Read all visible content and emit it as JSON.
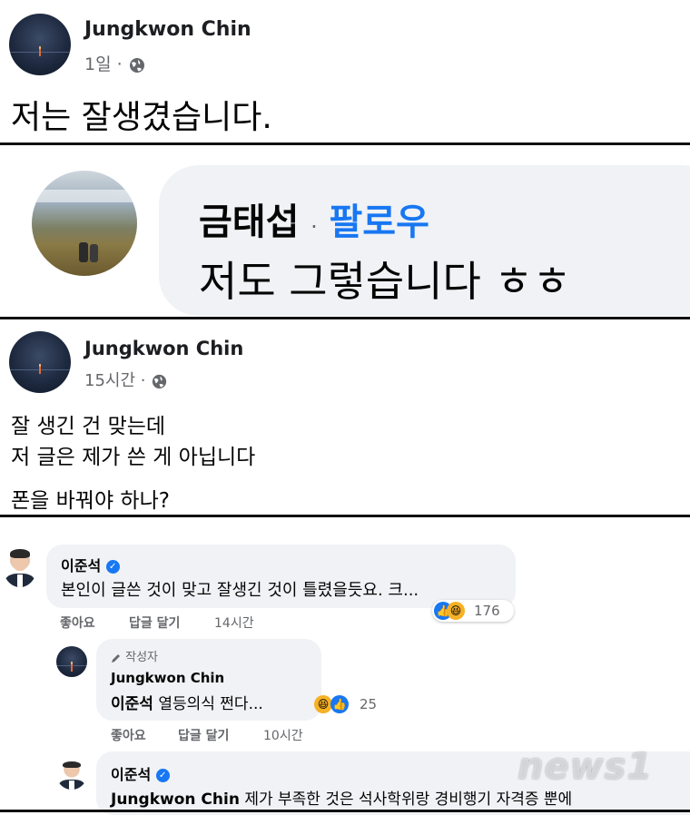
{
  "post1": {
    "author": "Jungkwon Chin",
    "time": "1일",
    "dot": "·",
    "body": "저는 잘생겼습니다."
  },
  "post2": {
    "commenter": "금태섭",
    "dot": "·",
    "follow_label": "팔로우",
    "comment": "저도 그렇습니다 ㅎㅎ"
  },
  "post3": {
    "author": "Jungkwon Chin",
    "time": "15시간",
    "dot": "·",
    "line1": "잘 생긴 건 맞는데",
    "line2": "저 글은 제가 쓴 게 아닙니다",
    "line3": "폰을 바꿔야 하나?"
  },
  "comments": {
    "c1": {
      "name": "이준석",
      "text": "본인이 글쓴 것이 맞고 잘생긴 것이 틀렸을듯요. 크...",
      "reaction_count": "176",
      "like_label": "좋아요",
      "reply_label": "답글 달기",
      "time": "14시간"
    },
    "c2": {
      "author_badge": "작성자",
      "name": "Jungkwon Chin",
      "mention": "이준석",
      "text": "열등의식 쩐다...",
      "reaction_count": "25",
      "like_label": "좋아요",
      "reply_label": "답글 달기",
      "time": "10시간"
    },
    "c3": {
      "name": "이준석",
      "mention": "Jungkwon Chin",
      "text": "제가 부족한 것은 석사학위랑 경비행기 자격증 뿐에"
    }
  },
  "watermark": "news1",
  "colors": {
    "link_blue": "#1877f2",
    "bubble_bg": "#f0f2f5",
    "meta_gray": "#65676b"
  }
}
